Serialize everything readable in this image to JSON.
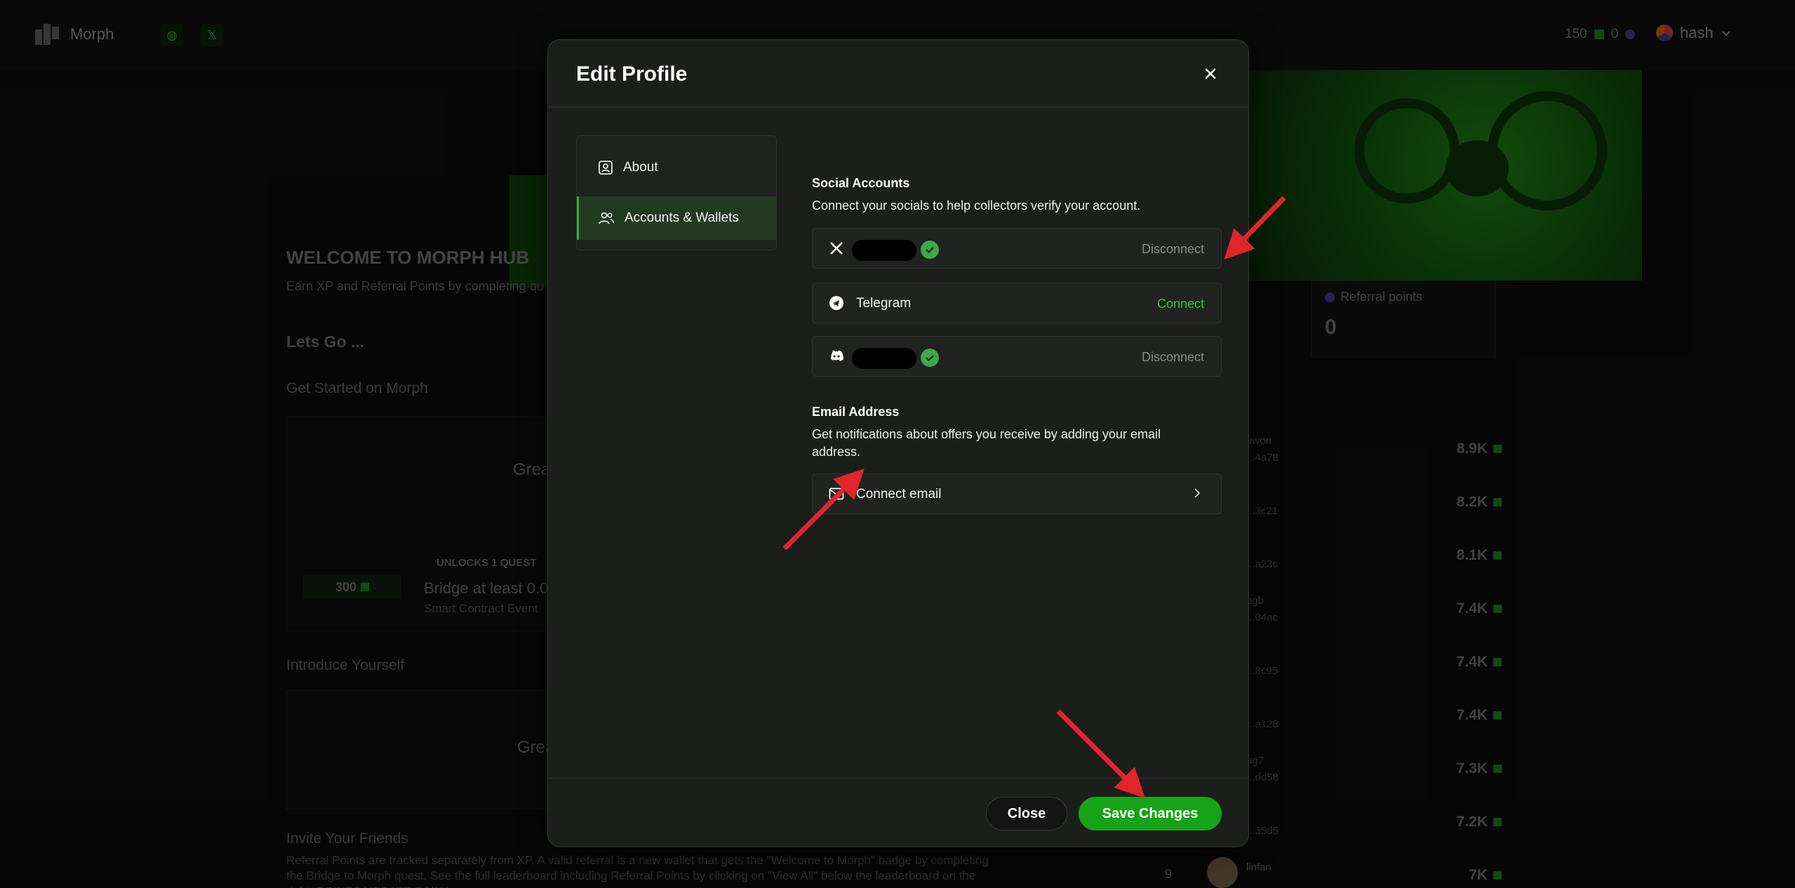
{
  "topbar": {
    "brand": "Morph",
    "xp_points": "150",
    "referral_points": "0",
    "username": "hash"
  },
  "background": {
    "welcome_title": "WELCOME TO MORPH HUB",
    "welcome_desc": "Earn XP and Referral Points by completing qu",
    "lets_go": "Lets Go ...",
    "get_started": "Get Started on Morph",
    "card_text_1": "Grea",
    "pill_points": "300",
    "unlocks": "UNLOCKS 1 QUEST",
    "bridge": "Bridge at least 0.00",
    "smart": "Smart Contract Event",
    "introduce": "Introduce Yourself",
    "card_text_2": "Grea",
    "invite": "Invite Your Friends",
    "referral_desc": "Referral Points are tracked separately from XP. A valid referral is a new wallet that gets the \"Welcome to Morph\" badge by completing the Bridge to Morph quest. See the full leaderboard including Referral Points by clicking on \"View All\" below the leaderboard on the right. POINTS UPDATE DAILY.",
    "referral_card_label": "Referral points",
    "referral_card_value": "0",
    "leaderboard": [
      {
        "name": "uwon",
        "addr": "...4a78",
        "points": "8.9K"
      },
      {
        "name": "",
        "addr": "...3c21",
        "points": "8.2K"
      },
      {
        "name": "",
        "addr": "...a23c",
        "points": "8.1K"
      },
      {
        "name": "ogb",
        "addr": "...04ac",
        "points": "7.4K"
      },
      {
        "name": "",
        "addr": "...8c95",
        "points": "7.4K"
      },
      {
        "name": "",
        "addr": "...a128",
        "points": "7.4K"
      },
      {
        "name": "ng7",
        "addr": "...dd58",
        "points": "7.3K"
      },
      {
        "name": "",
        "addr": "...35d5",
        "points": "7.2K"
      },
      {
        "rank": "9",
        "name": "linfan",
        "addr": "",
        "points": "7K"
      }
    ]
  },
  "modal": {
    "title": "Edit Profile",
    "nav": [
      {
        "label": "About",
        "icon": "user-card-icon"
      },
      {
        "label": "Accounts & Wallets",
        "icon": "users-icon"
      }
    ],
    "social": {
      "title": "Social Accounts",
      "desc": "Connect your socials to help collectors verify your account.",
      "accounts": [
        {
          "platform": "x",
          "icon": "x-logo-icon",
          "label": "",
          "action": "Disconnect"
        },
        {
          "platform": "telegram",
          "icon": "telegram-icon",
          "label": "Telegram",
          "action": "Connect"
        },
        {
          "platform": "discord",
          "icon": "discord-icon",
          "label": "",
          "action": "Disconnect"
        }
      ]
    },
    "email": {
      "title": "Email Address",
      "desc": "Get notifications about offers you receive by adding your email address.",
      "connect_label": "Connect email"
    },
    "buttons": {
      "close": "Close",
      "save": "Save Changes"
    }
  },
  "colors": {
    "accent_green": "#17a317",
    "connect_green": "#35c23a",
    "arrow_red": "#e0252b"
  }
}
